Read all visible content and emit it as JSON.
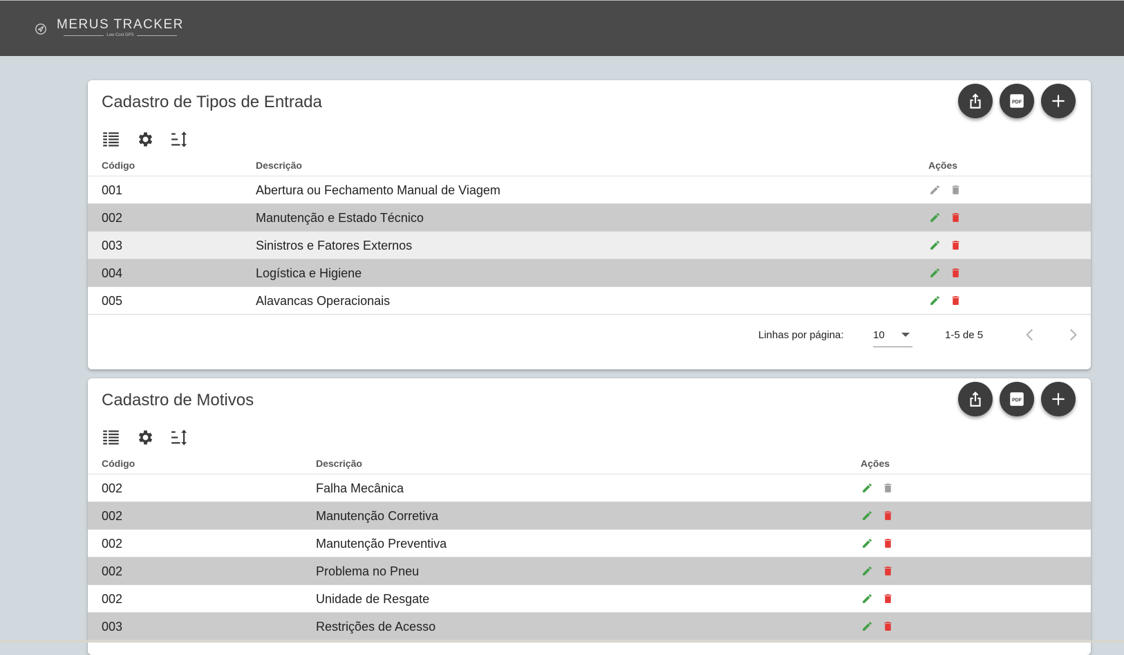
{
  "app": {
    "name": "MERUS TRACKER",
    "tagline": "Low Cost GPS"
  },
  "colors": {
    "topbar": "#4a4a4a",
    "background": "#d1d9de",
    "fab": "#3d3d3d",
    "edit": "#43a047",
    "delete": "#e53935",
    "disabled": "#9e9e9e"
  },
  "icons": {
    "toolbar": [
      "columns-icon",
      "gear-icon",
      "sort-icon"
    ],
    "fabs": [
      "share-icon",
      "pdf-icon",
      "add-icon"
    ],
    "row_actions": [
      "pencil-icon",
      "trash-icon"
    ]
  },
  "tipos_entrada": {
    "title": "Cadastro de Tipos de Entrada",
    "columns": [
      "Código",
      "Descrição",
      "Ações"
    ],
    "rows": [
      {
        "codigo": "001",
        "descricao": "Abertura ou Fechamento Manual de Viagem",
        "enabled": false
      },
      {
        "codigo": "002",
        "descricao": "Manutenção e Estado Técnico",
        "enabled": true
      },
      {
        "codigo": "003",
        "descricao": "Sinistros e Fatores Externos",
        "enabled": true
      },
      {
        "codigo": "004",
        "descricao": "Logística e Higiene",
        "enabled": true
      },
      {
        "codigo": "005",
        "descricao": "Alavancas Operacionais",
        "enabled": true
      }
    ],
    "pagination": {
      "rows_per_page_label": "Linhas por página:",
      "rows_per_page": "10",
      "range": "1-5 de 5"
    }
  },
  "motivos": {
    "title": "Cadastro de Motivos",
    "columns": [
      "Código",
      "Descrição",
      "Ações"
    ],
    "rows": [
      {
        "codigo": "002",
        "descricao": "Falha Mecânica",
        "enabled": false
      },
      {
        "codigo": "002",
        "descricao": "Manutenção Corretiva",
        "enabled": true
      },
      {
        "codigo": "002",
        "descricao": "Manutenção Preventiva",
        "enabled": true
      },
      {
        "codigo": "002",
        "descricao": "Problema no Pneu",
        "enabled": true
      },
      {
        "codigo": "002",
        "descricao": "Unidade de Resgate",
        "enabled": true
      },
      {
        "codigo": "003",
        "descricao": "Restrições de Acesso",
        "enabled": true
      }
    ]
  }
}
